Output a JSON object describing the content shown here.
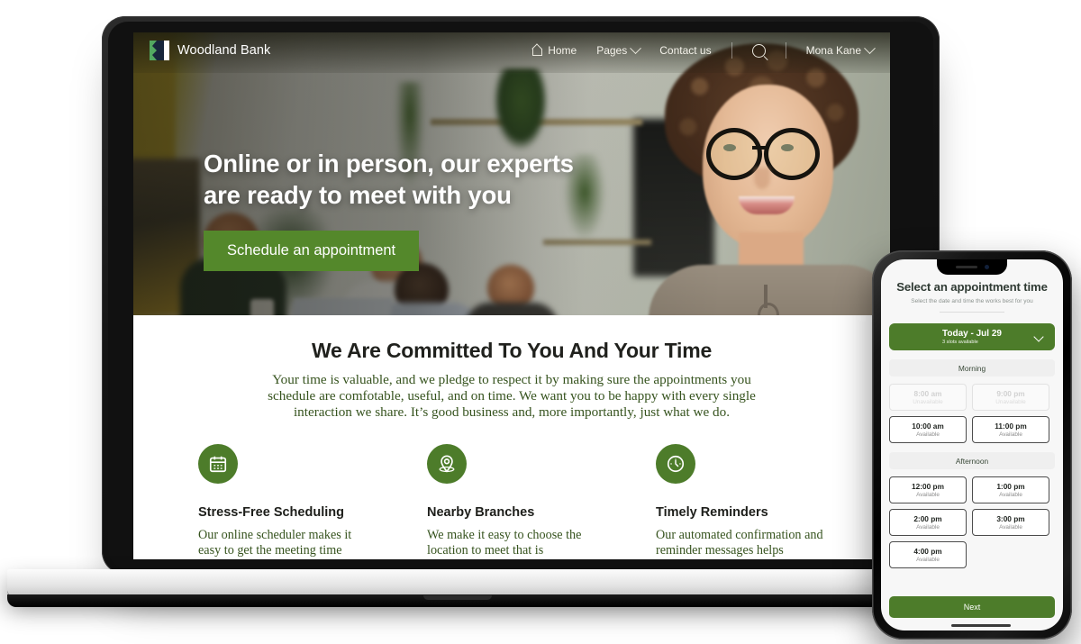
{
  "site": {
    "brand": {
      "name": "Woodland Bank",
      "logo_icon": "woodland-bank-logo"
    },
    "nav": {
      "home": "Home",
      "pages": "Pages",
      "contact": "Contact us",
      "search_icon": "search-icon",
      "user": "Mona Kane"
    },
    "hero": {
      "title_line1": "Online or in person, our experts",
      "title_line2": "are ready to meet with you",
      "cta": "Schedule an appointment"
    },
    "committed": {
      "heading": "We Are Committed To You And Your Time",
      "body": "Your time is valuable, and we pledge to respect it by making sure the appointments you schedule are comfotable, useful, and on time. We want you to be happy with every single interaction we share. It’s good business and, more importantly, just what we do."
    },
    "features": [
      {
        "icon": "calendar-icon",
        "title": "Stress-Free Scheduling",
        "body": "Our online scheduler makes it easy to get the meeting time"
      },
      {
        "icon": "map-pin-icon",
        "title": "Nearby Branches",
        "body": "We make it easy to choose the location to meet that is"
      },
      {
        "icon": "clock-icon",
        "title": "Timely Reminders",
        "body": "Our automated confirmation and reminder messages helps"
      }
    ]
  },
  "phone": {
    "title": "Select an appointment time",
    "subtitle": "Select the date and time the works best for you",
    "date_selector": {
      "label": "Today - Jul 29",
      "slots_available": "3 slots available",
      "chevron_icon": "chevron-down-icon"
    },
    "sections": [
      {
        "label": "Morning",
        "slots": [
          {
            "time": "8:00 am",
            "status": "Unavailable",
            "available": false
          },
          {
            "time": "9:00 pm",
            "status": "Unavailable",
            "available": false
          },
          {
            "time": "10:00 am",
            "status": "Available",
            "available": true
          },
          {
            "time": "11:00 pm",
            "status": "Available",
            "available": true
          }
        ]
      },
      {
        "label": "Afternoon",
        "slots": [
          {
            "time": "12:00 pm",
            "status": "Available",
            "available": true
          },
          {
            "time": "1:00 pm",
            "status": "Available",
            "available": true
          },
          {
            "time": "2:00 pm",
            "status": "Available",
            "available": true
          },
          {
            "time": "3:00 pm",
            "status": "Available",
            "available": true
          },
          {
            "time": "4:00 pm",
            "status": "Available",
            "available": true
          }
        ]
      }
    ],
    "next_button": "Next"
  },
  "colors": {
    "brand_green": "#4d7c2a",
    "cta_green": "#54882b",
    "body_text_green": "#36531e",
    "heading_dark": "#20211d"
  }
}
